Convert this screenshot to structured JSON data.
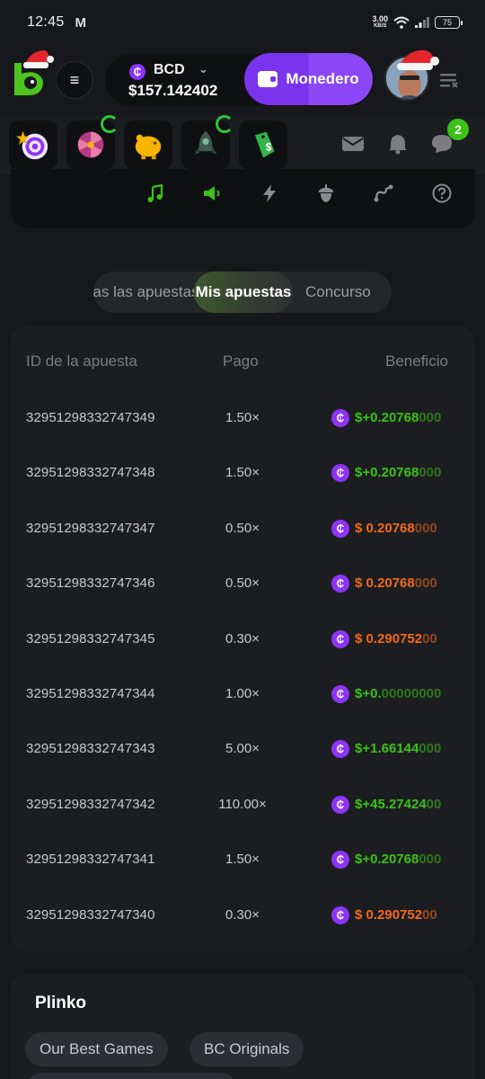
{
  "status_bar": {
    "time": "12:45",
    "mail_icon": "M",
    "speed_value": "3.00",
    "speed_unit": "KB/S",
    "battery": "75"
  },
  "header": {
    "currency": "BCD",
    "balance": "$157.142402",
    "wallet_button": "Monedero",
    "menu_icon": "≡"
  },
  "tabs": {
    "all": "Todas las apuestas",
    "mine": "Mis apuestas",
    "contest": "Concurso"
  },
  "notifications_badge": "2",
  "bets": {
    "headers": {
      "id": "ID de la apuesta",
      "payout": "Pago",
      "profit": "Beneficio"
    },
    "rows": [
      {
        "id": "32951298332747349",
        "payout": "1.50×",
        "profit_main": "$+0.20768",
        "profit_tail": "000",
        "status": "win"
      },
      {
        "id": "32951298332747348",
        "payout": "1.50×",
        "profit_main": "$+0.20768",
        "profit_tail": "000",
        "status": "win"
      },
      {
        "id": "32951298332747347",
        "payout": "0.50×",
        "profit_main": "$  0.20768",
        "profit_tail": "000",
        "status": "loss"
      },
      {
        "id": "32951298332747346",
        "payout": "0.50×",
        "profit_main": "$  0.20768",
        "profit_tail": "000",
        "status": "loss"
      },
      {
        "id": "32951298332747345",
        "payout": "0.30×",
        "profit_main": "$  0.290752",
        "profit_tail": "00",
        "status": "loss"
      },
      {
        "id": "32951298332747344",
        "payout": "1.00×",
        "profit_main": "$+0.",
        "profit_tail": "00000000",
        "status": "win"
      },
      {
        "id": "32951298332747343",
        "payout": "5.00×",
        "profit_main": "$+1.66144",
        "profit_tail": "000",
        "status": "win"
      },
      {
        "id": "32951298332747342",
        "payout": "110.00×",
        "profit_main": "$+45.27424",
        "profit_tail": "00",
        "status": "win"
      },
      {
        "id": "32951298332747341",
        "payout": "1.50×",
        "profit_main": "$+0.20768",
        "profit_tail": "000",
        "status": "win"
      },
      {
        "id": "32951298332747340",
        "payout": "0.30×",
        "profit_main": "$  0.290752",
        "profit_tail": "00",
        "status": "loss"
      }
    ]
  },
  "plinko": {
    "title": "Plinko",
    "chips": [
      "Our Best Games",
      "BC Originals"
    ]
  },
  "colors": {
    "accent_purple": "#7a34ee",
    "win_green": "#3bc117",
    "loss_orange": "#f26a1b",
    "background": "#17181b"
  }
}
